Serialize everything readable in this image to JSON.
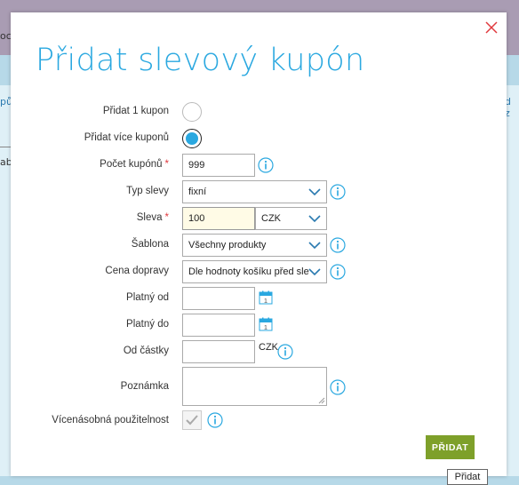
{
  "background": {
    "topbar_text": "oc",
    "left_snippet": "pů",
    "right_snippet": "d z",
    "tab_snippet": "ab"
  },
  "modal": {
    "title": "Přidat slevový kupón",
    "close_icon": "close-icon"
  },
  "form": {
    "single_coupon_label": "Přidat 1 kupon",
    "single_coupon_selected": false,
    "multiple_coupons_label": "Přidat více kuponů",
    "multiple_coupons_selected": true,
    "coupon_count_label": "Počet kupónů",
    "coupon_count_value": "999",
    "discount_type_label": "Typ slevy",
    "discount_type_value": "fixní",
    "discount_label": "Sleva",
    "discount_value": "100",
    "currency_value": "CZK",
    "template_label": "Šablona",
    "template_value": "Všechny produkty",
    "shipping_price_label": "Cena dopravy",
    "shipping_price_value": "Dle hodnoty košíku před sle",
    "valid_from_label": "Platný od",
    "valid_from_value": "",
    "valid_to_label": "Platný do",
    "valid_to_value": "",
    "from_amount_label": "Od částky",
    "from_amount_value": "",
    "from_amount_currency": "CZK",
    "note_label": "Poznámka",
    "note_value": "",
    "multi_use_label": "Vícenásobná použitelnost",
    "multi_use_checked": true,
    "required_marker": "*",
    "calendar_day": "1"
  },
  "actions": {
    "add_label": "PŘIDAT",
    "add_tooltip": "Přidat"
  },
  "colors": {
    "accent": "#2aa8e0",
    "button": "#7ea02a",
    "required": "#e0393e"
  }
}
